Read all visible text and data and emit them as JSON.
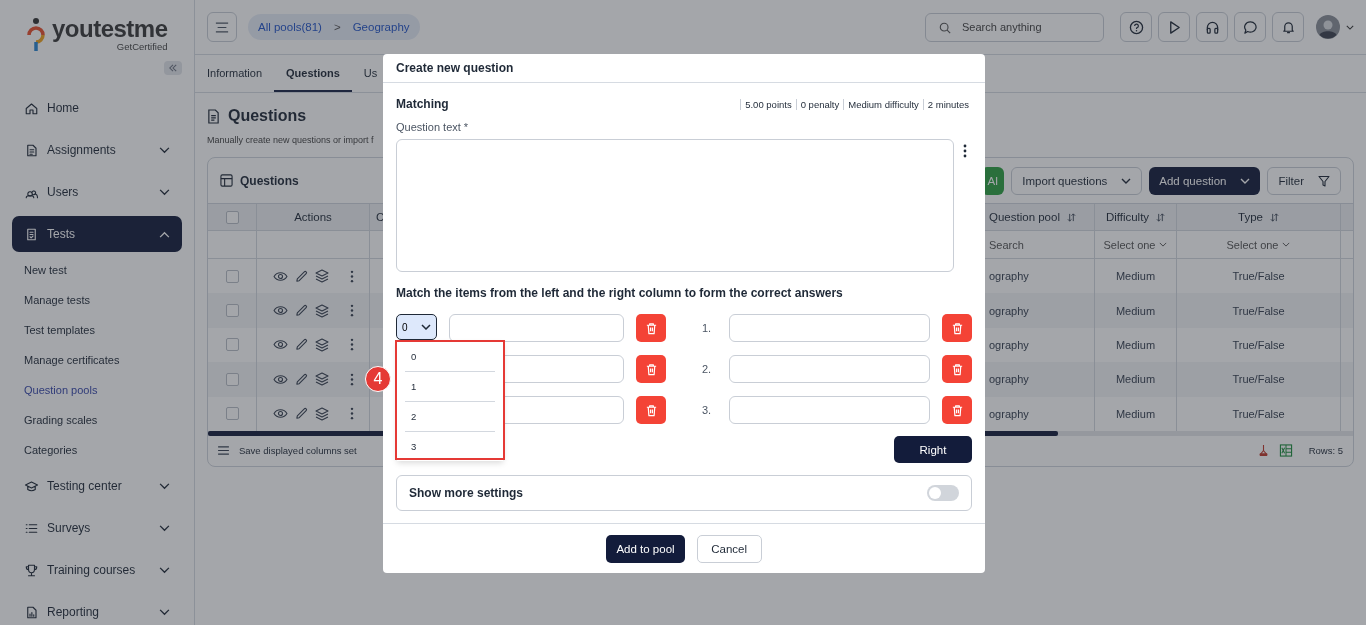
{
  "sidebar": {
    "logo": {
      "name": "youtestme",
      "tagline": "GetCertified"
    },
    "items": [
      {
        "label": "Home",
        "kind": "link",
        "selected": false
      },
      {
        "label": "Assignments",
        "kind": "group",
        "selected": false,
        "expanded": false
      },
      {
        "label": "Users",
        "kind": "group",
        "selected": false,
        "expanded": false
      },
      {
        "label": "Tests",
        "kind": "group",
        "selected": true,
        "expanded": true,
        "children": [
          {
            "label": "New test",
            "selected": false
          },
          {
            "label": "Manage tests",
            "selected": false
          },
          {
            "label": "Test templates",
            "selected": false
          },
          {
            "label": "Manage certificates",
            "selected": false
          },
          {
            "label": "Question pools",
            "selected": true
          },
          {
            "label": "Grading scales",
            "selected": false
          },
          {
            "label": "Categories",
            "selected": false
          }
        ]
      },
      {
        "label": "Testing center",
        "kind": "group",
        "selected": false,
        "expanded": false
      },
      {
        "label": "Surveys",
        "kind": "group",
        "selected": false,
        "expanded": false
      },
      {
        "label": "Training courses",
        "kind": "group",
        "selected": false,
        "expanded": false
      },
      {
        "label": "Reporting",
        "kind": "group",
        "selected": false,
        "expanded": false
      }
    ]
  },
  "topbar": {
    "breadcrumb": [
      {
        "label": "All pools(81)"
      },
      {
        "label": "Geography"
      }
    ],
    "separator": ">",
    "search": {
      "placeholder": "Search anything"
    }
  },
  "tabs": [
    {
      "label": "Information",
      "selected": false
    },
    {
      "label": "Questions",
      "selected": true
    },
    {
      "label": "Us",
      "selected": false
    }
  ],
  "page": {
    "title": "Questions",
    "description": "Manually create new questions or import f"
  },
  "table": {
    "title": "Questions",
    "actions": [
      {
        "label": "AI",
        "kind": "ai"
      },
      {
        "label": "Import questions",
        "kind": "menu"
      },
      {
        "label": "Add question",
        "kind": "primary"
      },
      {
        "label": "Filter",
        "kind": "filter"
      }
    ],
    "columns": [
      {
        "label": "Actions",
        "sortable": false
      },
      {
        "label": "C",
        "sortable": false
      },
      {
        "label": "Question pool",
        "sortable": true
      },
      {
        "label": "Difficulty",
        "sortable": true
      },
      {
        "label": "Type",
        "sortable": true
      }
    ],
    "select_all_checked": false,
    "filters": {
      "question_pool": "Search",
      "difficulty": "Select one",
      "type": "Select one"
    },
    "rows": [
      {
        "checked": false,
        "question_pool": "ography",
        "difficulty": "Medium",
        "type": "True/False"
      },
      {
        "checked": false,
        "question_pool": "ography",
        "difficulty": "Medium",
        "type": "True/False"
      },
      {
        "checked": false,
        "question_pool": "ography",
        "difficulty": "Medium",
        "type": "True/False"
      },
      {
        "checked": false,
        "question_pool": "ography",
        "difficulty": "Medium",
        "type": "True/False"
      },
      {
        "checked": false,
        "question_pool": "ography",
        "difficulty": "Medium",
        "type": "True/False"
      }
    ],
    "footer": {
      "save_label": "Save displayed columns set",
      "rows_count": "Rows: 5"
    }
  },
  "modal": {
    "title": "Create new question",
    "question_type": "Matching",
    "meta": [
      "5.00 points",
      "0 penalty",
      "Medium difficulty",
      "2 minutes"
    ],
    "question_label": "Question text *",
    "instruction": "Match the items from the left and the right column to form the correct answers",
    "pairs": [
      {
        "left_order": "0",
        "right_number": "1."
      },
      {
        "right_number": "2."
      },
      {
        "right_number": "3."
      }
    ],
    "order_menu": {
      "options": [
        "0",
        "1",
        "2",
        "3"
      ]
    },
    "right_button": "Right",
    "settings_toggle": {
      "label": "Show more settings",
      "on": false
    },
    "footer_buttons": [
      {
        "label": "Add to pool",
        "kind": "primary"
      },
      {
        "label": "Cancel",
        "kind": "secondary"
      }
    ],
    "callout": {
      "number": "4"
    }
  }
}
